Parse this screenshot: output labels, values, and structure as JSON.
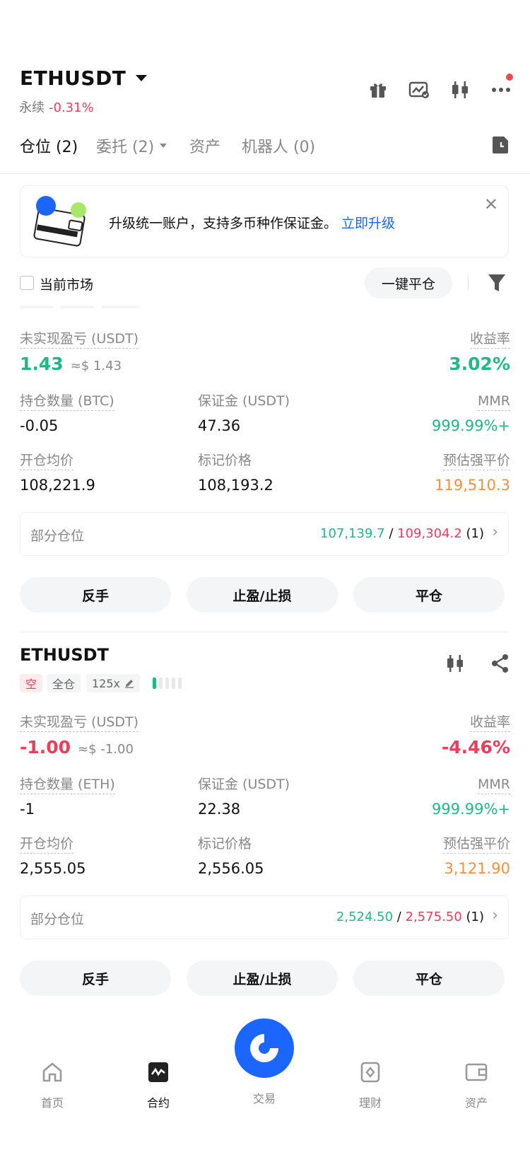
{
  "header": {
    "symbol": "ETHUSDT",
    "contract_type": "永续",
    "change": "-0.31%"
  },
  "tabs": [
    {
      "label": "仓位 (2)"
    },
    {
      "label": "委托 (2)"
    },
    {
      "label": "资产"
    },
    {
      "label": "机器人 (0)"
    }
  ],
  "banner": {
    "text": "升级统一账户，支持多币种作保证金。",
    "link": "立即升级"
  },
  "filters": {
    "current_market": "当前市场",
    "close_all": "一键平仓"
  },
  "positions": [
    {
      "pnl_label": "未实现盈亏 (USDT)",
      "pnl": "1.43",
      "pnl_usd": "≈$ 1.43",
      "roe_label": "收益率",
      "roe": "3.02%",
      "qty_label": "持仓数量 (BTC)",
      "qty": "-0.05",
      "margin_label": "保证金 (USDT)",
      "margin": "47.36",
      "mmr_label": "MMR",
      "mmr": "999.99%+",
      "entry_label": "开仓均价",
      "entry": "108,221.9",
      "mark_label": "标记价格",
      "mark": "108,193.2",
      "liq_label": "预估强平价",
      "liq": "119,510.3",
      "partial_label": "部分仓位",
      "tp": "107,139.7",
      "sl": "109,304.2",
      "partial_count": "(1)",
      "btn_reverse": "反手",
      "btn_tpsl": "止盈/止损",
      "btn_close": "平仓"
    },
    {
      "symbol": "ETHUSDT",
      "side": "空",
      "margin_mode": "全仓",
      "leverage": "125x",
      "pnl_label": "未实现盈亏 (USDT)",
      "pnl": "-1.00",
      "pnl_usd": "≈$ -1.00",
      "roe_label": "收益率",
      "roe": "-4.46%",
      "qty_label": "持仓数量 (ETH)",
      "qty": "-1",
      "margin_label": "保证金 (USDT)",
      "margin": "22.38",
      "mmr_label": "MMR",
      "mmr": "999.99%+",
      "entry_label": "开仓均价",
      "entry": "2,555.05",
      "mark_label": "标记价格",
      "mark": "2,556.05",
      "liq_label": "预估强平价",
      "liq": "3,121.90",
      "partial_label": "部分仓位",
      "tp": "2,524.50",
      "sl": "2,575.50",
      "partial_count": "(1)",
      "btn_reverse": "反手",
      "btn_tpsl": "止盈/止损",
      "btn_close": "平仓"
    }
  ],
  "nav": {
    "home": "首页",
    "contract": "合约",
    "trade": "交易",
    "earn": "理财",
    "assets": "资产"
  },
  "colors": {
    "green": "#23b784",
    "red": "#ea3e5a",
    "orange": "#f7903b",
    "blue": "#1a66ff"
  }
}
